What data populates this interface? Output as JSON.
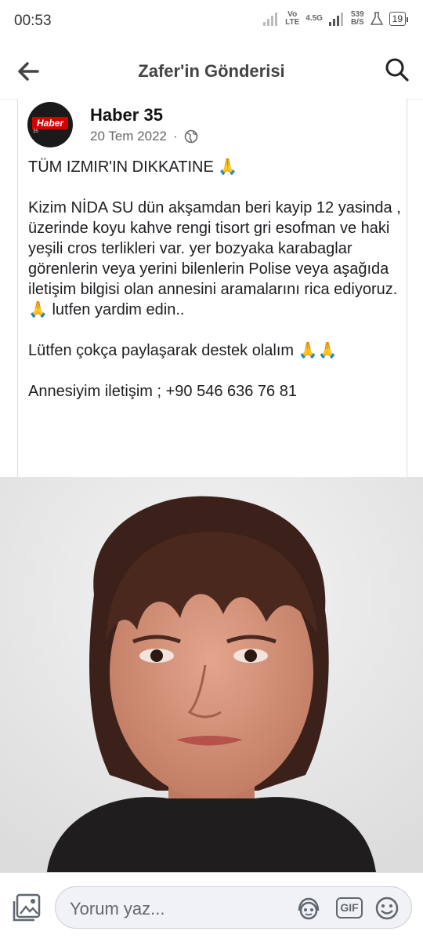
{
  "status": {
    "time": "00:53",
    "network_top": "Vo",
    "network_bottom": "LTE",
    "network_gen": "4.5G",
    "speed_value": "539",
    "speed_unit": "B/S",
    "battery": "19"
  },
  "header": {
    "title": "Zafer'in Gönderisi",
    "back_icon": "arrow-left-icon",
    "search_icon": "search-icon"
  },
  "post": {
    "avatar_logo": "Haber",
    "avatar_sub": "35",
    "author": "Haber 35",
    "date": "20 Tem 2022",
    "separator": "·",
    "privacy_icon": "globe-icon",
    "paragraphs": [
      "TÜM IZMIR'IN DIKKATINE 🙏",
      "Kizim NİDA SU dün akşamdan beri kayip 12 yasinda , üzerinde koyu kahve rengi tisort gri esofman ve haki yeşili cros terlikleri var. yer bozyaka karabaglar görenlerin veya yerini bilenlerin Polise veya aşağıda iletişim bilgisi olan annesini aramalarını rica ediyoruz.🙏 lutfen yardim edin..",
      "Lütfen çokça paylaşarak destek olalım 🙏🙏",
      "Annesiyim iletişim ; +90 546 636 76 81"
    ]
  },
  "composer": {
    "placeholder": "Yorum yaz...",
    "photo_icon": "photo-icon",
    "avatar_sticker_icon": "avatar-sticker-icon",
    "gif_label": "GIF",
    "emoji_icon": "emoji-icon"
  }
}
